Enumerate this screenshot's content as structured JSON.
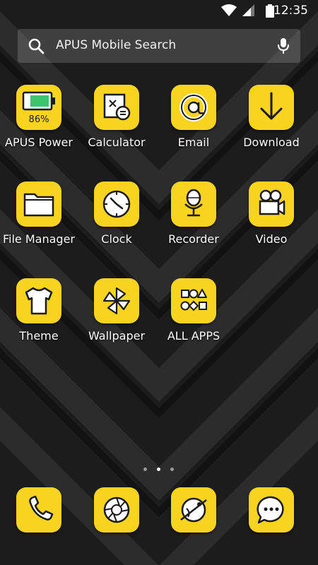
{
  "status_bar": {
    "time": "12:35"
  },
  "search": {
    "placeholder": "APUS Mobile Search"
  },
  "apps": [
    {
      "label": "APUS Power",
      "icon": "battery-icon",
      "battery_percent": "86%"
    },
    {
      "label": "Calculator",
      "icon": "calculator-icon"
    },
    {
      "label": "Email",
      "icon": "at-sign-icon"
    },
    {
      "label": "Download",
      "icon": "download-arrow-icon"
    },
    {
      "label": "File Manager",
      "icon": "folder-icon"
    },
    {
      "label": "Clock",
      "icon": "clock-icon"
    },
    {
      "label": "Recorder",
      "icon": "microphone-icon"
    },
    {
      "label": "Video",
      "icon": "video-camera-icon"
    },
    {
      "label": "Theme",
      "icon": "tshirt-icon"
    },
    {
      "label": "Wallpaper",
      "icon": "pinwheel-icon"
    },
    {
      "label": "ALL APPS",
      "icon": "shapes-icon"
    }
  ],
  "dock": [
    {
      "icon": "phone-icon"
    },
    {
      "icon": "camera-aperture-icon"
    },
    {
      "icon": "planet-browser-icon"
    },
    {
      "icon": "chat-bubble-icon"
    }
  ],
  "page_indicator": {
    "pages": 3,
    "active": 2
  },
  "colors": {
    "tile": "#f8d41e",
    "icon_stroke": "#1a1a1a",
    "wallpaper": "#1b1b1b"
  }
}
